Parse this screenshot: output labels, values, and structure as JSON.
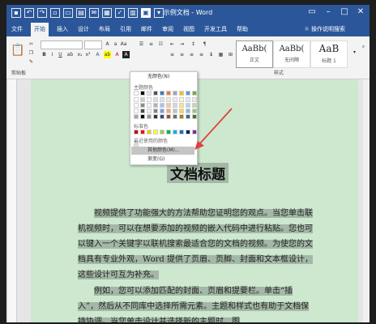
{
  "titlebar": {
    "title": "示例文档 - Word"
  },
  "tabs": [
    "文件",
    "开始",
    "插入",
    "设计",
    "布局",
    "引用",
    "邮件",
    "审阅",
    "视图",
    "开发工具",
    "帮助"
  ],
  "tellme": "操作说明搜索",
  "styles": [
    {
      "sample": "AaBb(",
      "name": "正文"
    },
    {
      "sample": "AaBb(",
      "name": "无间隔"
    },
    {
      "sample": "AaB",
      "name": "标题 1"
    }
  ],
  "group_labels": {
    "clipboard": "剪贴板",
    "styles": "样式"
  },
  "dropdown": {
    "top_item": "无颜色(N)",
    "theme_label": "主题颜色",
    "standard_label": "标准色",
    "recent_label": "最近使用的颜色",
    "more_item": "其他颜色(M)...",
    "fill_item": "渐变(G)"
  },
  "colors": {
    "theme": [
      "#ffffff",
      "#000000",
      "#e7e6e6",
      "#44546a",
      "#4472c4",
      "#ed7d31",
      "#a5a5a5",
      "#ffc000",
      "#5b9bd5",
      "#70ad47"
    ],
    "standard": [
      "#c00000",
      "#ff0000",
      "#ffc000",
      "#ffff00",
      "#92d050",
      "#00b050",
      "#00b0f0",
      "#0070c0",
      "#002060",
      "#7030a0"
    ],
    "accent": "#e04040",
    "highlight_bg": "#a3b8a6",
    "page_bg": "#cde8cf",
    "ribbon_blue": "#2b579a"
  },
  "document": {
    "title": "文档标题",
    "paragraphs": [
      "视频提供了功能强大的方法帮助您证明您的观点。当您单击联机视频时，可以在想要添加的视频的嵌入代码中进行粘贴。您也可以键入一个关键字以联机搜索最适合您的文档的视频。为使您的文档具有专业外观，Word 提供了页眉、页脚、封面和文本框设计，这些设计可互为补充。",
      "例如，您可以添加匹配的封面、页眉和提要栏。单击“插入”，然后从不同库中选择所需元素。主题和样式也有助于文档保持协调。当您单击设计并选择新的主题时，图"
    ]
  }
}
